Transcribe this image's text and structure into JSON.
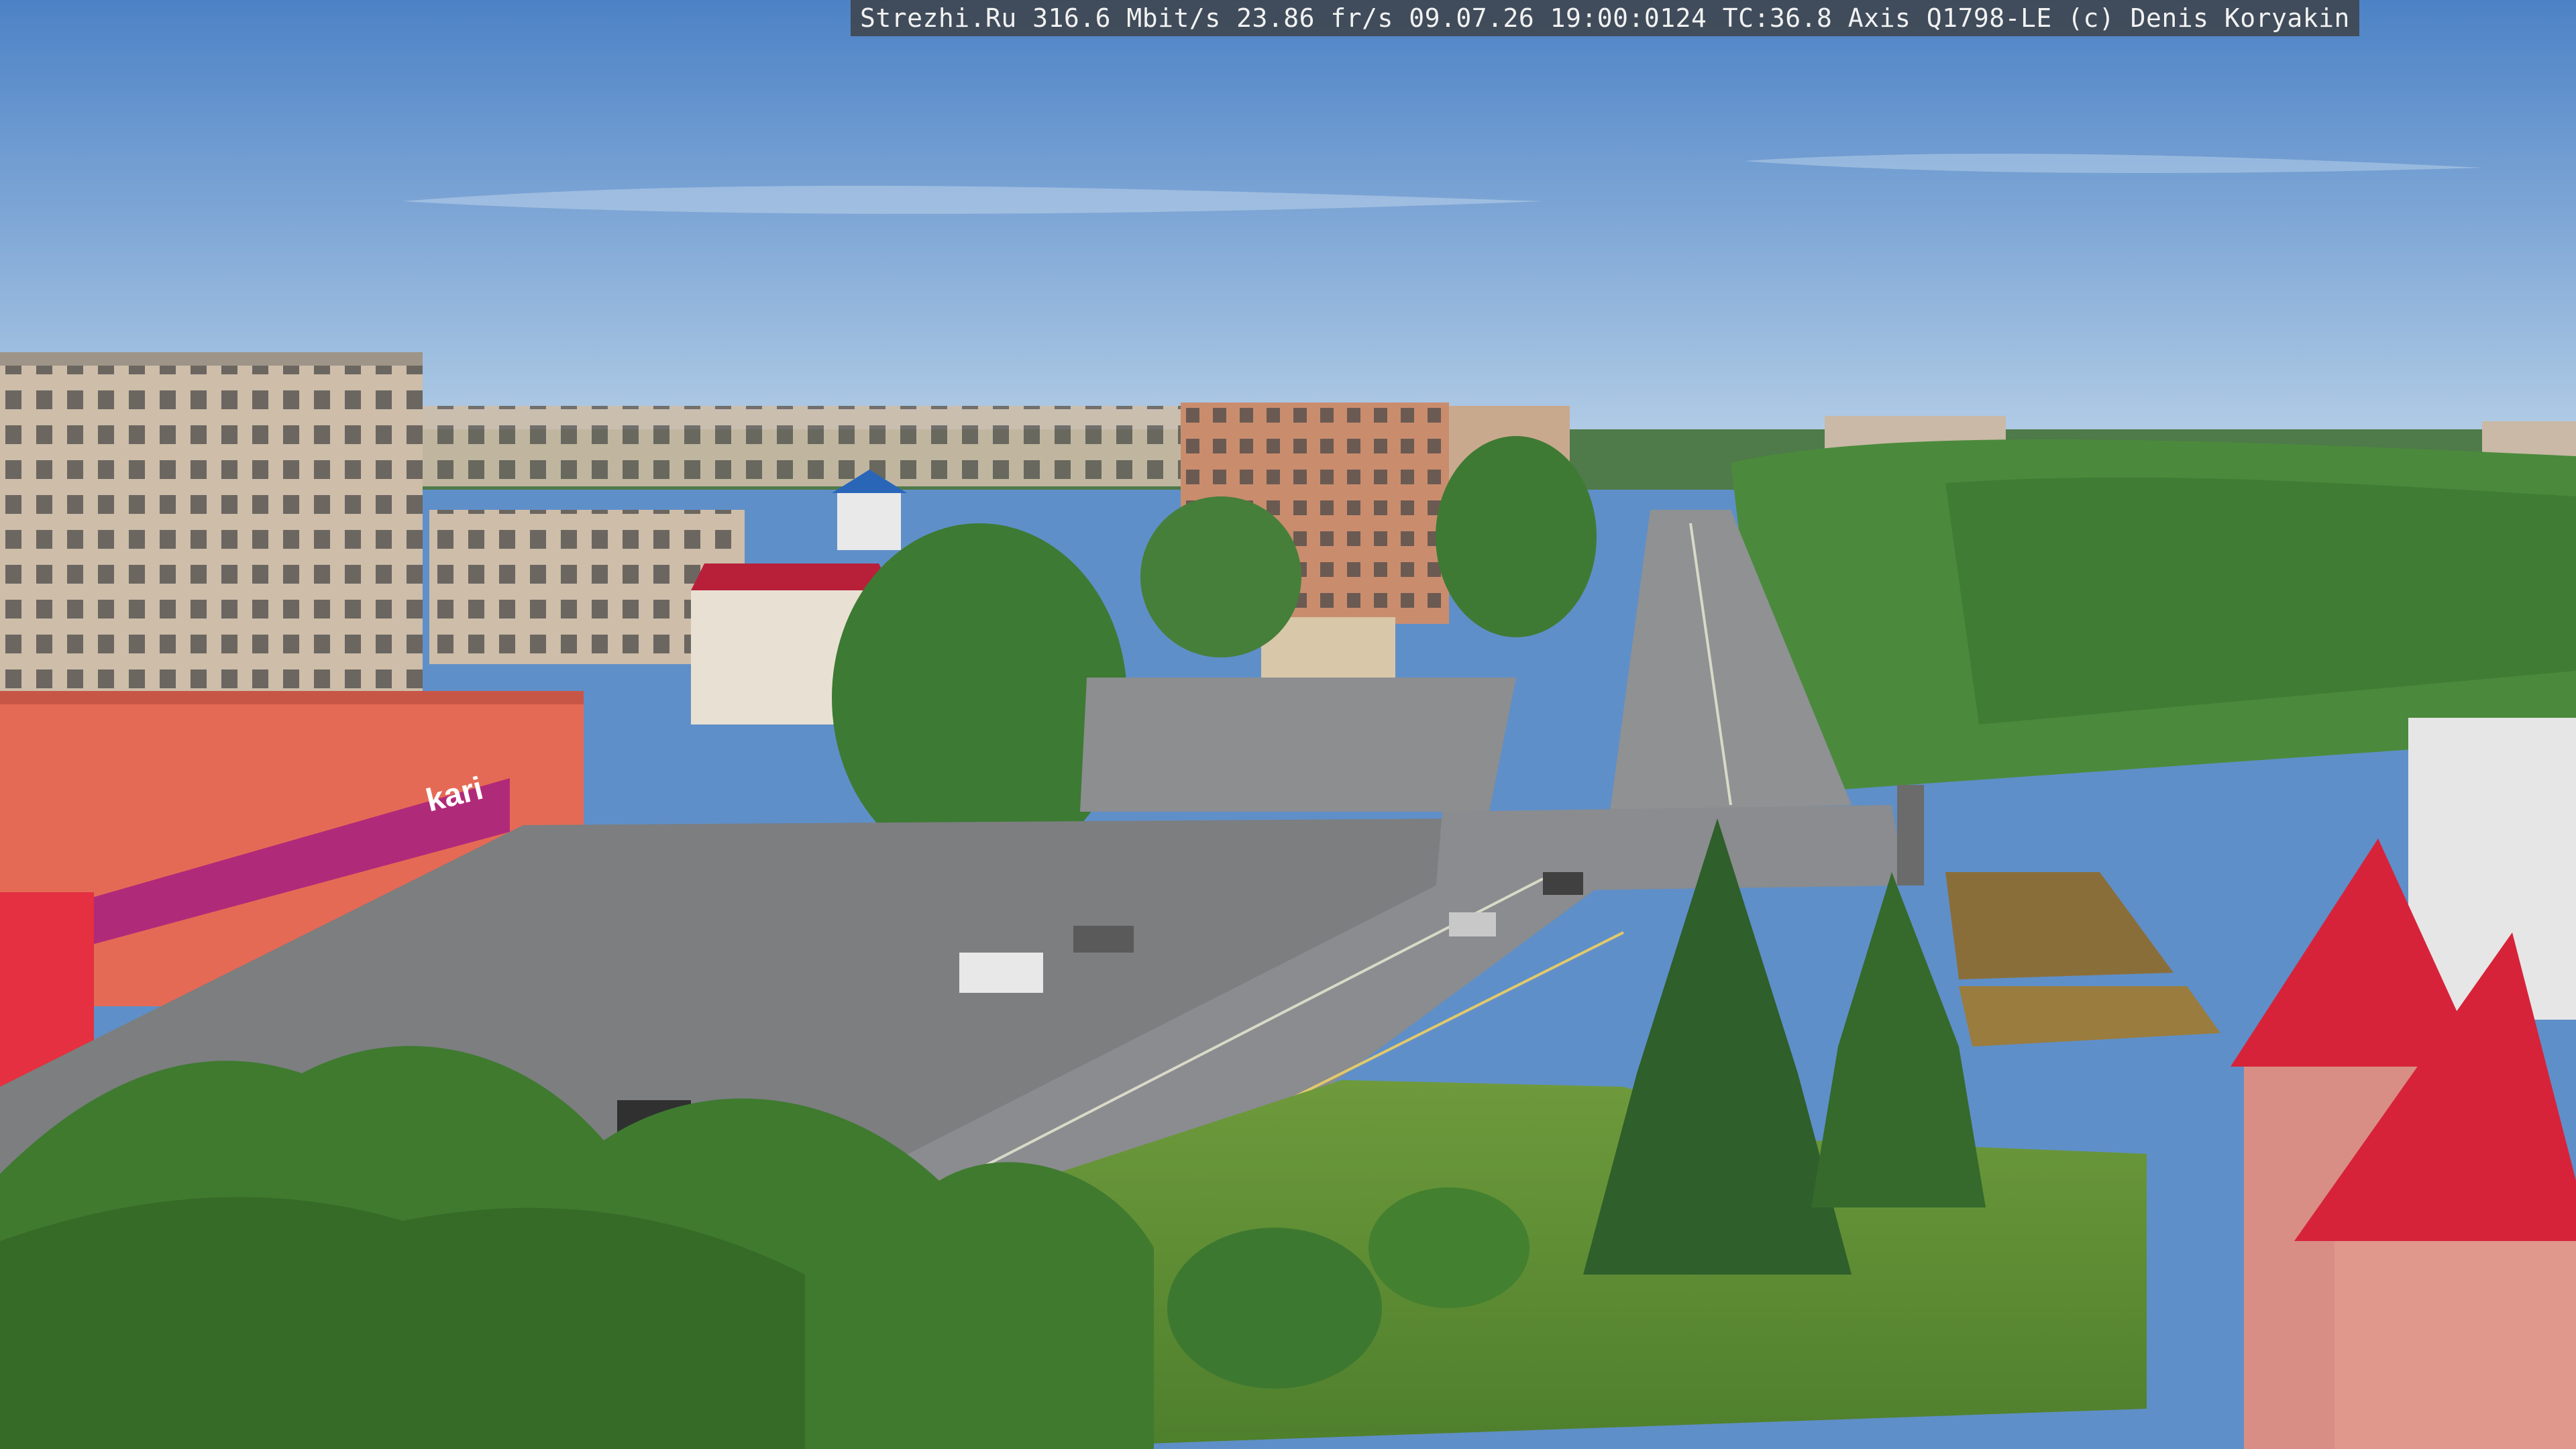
{
  "overlay": {
    "text": "Strezhi.Ru 316.6 Mbit/s 23.86 fr/s 09.07.26 19:00:0124 TC:36.8  Axis Q1798-LE  (c) Denis Koryakin"
  },
  "signs": {
    "store": "kari"
  },
  "colors": {
    "sky_top": "#4f86c9",
    "sky_bottom": "#a9c6e2",
    "foliage": "#3f7a34",
    "road": "#8a8c8f",
    "plaza": "#7c7e80",
    "panel_block": "#c9b9a6",
    "brick_block": "#c98d6e",
    "store_front": "#e56a55",
    "store_banner": "#b02a7a",
    "roof_red": "#d6233a"
  }
}
